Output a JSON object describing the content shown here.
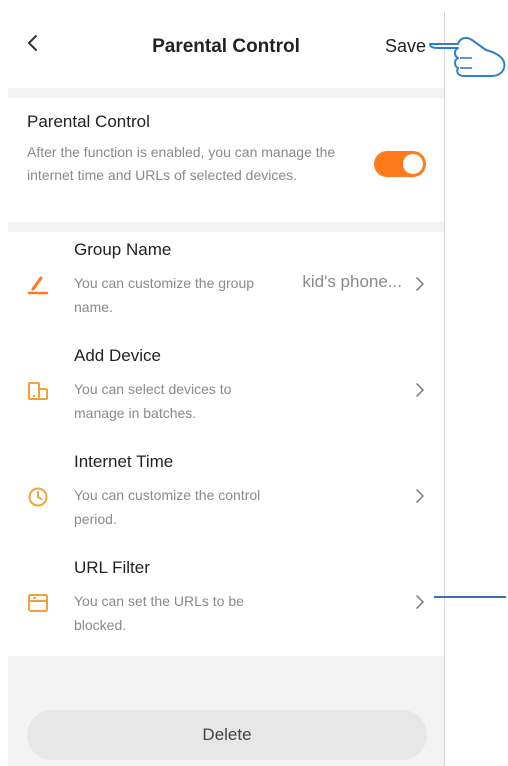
{
  "header": {
    "back_icon": "chevron-left-icon",
    "title": "Parental Control",
    "save_label": "Save"
  },
  "parental_control": {
    "title": "Parental Control",
    "description": "After the function is enabled, you can manage the internet time and URLs of selected devices.",
    "enabled": true
  },
  "items": [
    {
      "icon": "pencil-icon",
      "title": "Group Name",
      "description": "You can customize the group name.",
      "value": "kid's phone..."
    },
    {
      "icon": "device-icon",
      "title": "Add Device",
      "description": "You can select devices to manage in batches.",
      "value": ""
    },
    {
      "icon": "clock-icon",
      "title": "Internet Time",
      "description": "You can customize the control period.",
      "value": ""
    },
    {
      "icon": "url-filter-icon",
      "title": "URL Filter",
      "description": "You can set the URLs to be blocked.",
      "value": ""
    }
  ],
  "delete_label": "Delete",
  "colors": {
    "accent": "#ff7a1a",
    "callout": "#3a6fb0"
  }
}
